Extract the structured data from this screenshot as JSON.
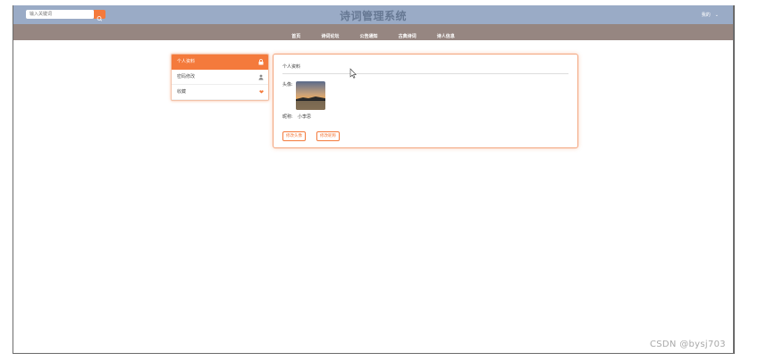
{
  "header": {
    "search_placeholder": "输入关键词",
    "title": "诗词管理系统",
    "user_label": "我的"
  },
  "nav": {
    "items": [
      {
        "label": "首页"
      },
      {
        "label": "诗词论坛"
      },
      {
        "label": "公告通知"
      },
      {
        "label": "古典诗词"
      },
      {
        "label": "诗人信息"
      }
    ]
  },
  "sidebar": {
    "items": [
      {
        "label": "个人资料",
        "icon": "lock-icon",
        "active": true
      },
      {
        "label": "密码修改",
        "icon": "person-icon",
        "active": false
      },
      {
        "label": "收藏",
        "icon": "heart-icon",
        "active": false
      }
    ]
  },
  "profile": {
    "title": "个人资料",
    "avatar_label": "头像:",
    "nickname_label": "昵称:",
    "nickname_value": "小李思",
    "change_avatar_label": "修改头像",
    "change_nickname_label": "修改昵称"
  },
  "watermark": "CSDN @bysj703",
  "colors": {
    "topbar": "#9aabc6",
    "navbar": "#968681",
    "accent": "#f47a3c",
    "title": "#667893"
  }
}
